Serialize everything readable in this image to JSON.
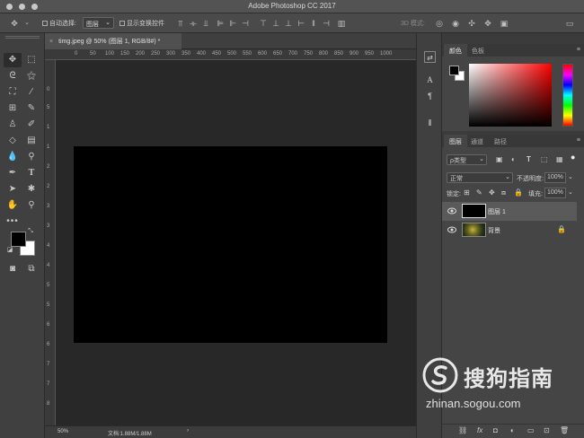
{
  "window": {
    "title": "Adobe Photoshop CC 2017"
  },
  "options_bar": {
    "auto_select_label": "自动选择:",
    "auto_select_value": "图层",
    "show_transform_label": "显示变换控件",
    "mode_3d_label": "3D 模式:"
  },
  "document": {
    "tab_label": "timg.jpeg @ 50% (图层 1, RGB/8#) *",
    "close_glyph": "×",
    "ruler_h": [
      "0",
      "50",
      "100",
      "150",
      "200",
      "250",
      "300",
      "350",
      "400",
      "450",
      "500",
      "550",
      "600",
      "650",
      "700",
      "750",
      "800",
      "850",
      "900",
      "950",
      "1000"
    ],
    "ruler_v": [
      "0",
      "5",
      "1",
      "1",
      "2",
      "2",
      "3",
      "3",
      "4",
      "4",
      "5",
      "5",
      "6",
      "6",
      "7",
      "7",
      "8"
    ],
    "zoom": "50%",
    "doc_info": "文档:1.88M/1.88M",
    "status_arrow": "›",
    "fill_color": "#000000"
  },
  "color_panel": {
    "tabs": [
      "颜色",
      "色板"
    ],
    "foreground": "#000000",
    "background": "#ffffff",
    "hue": "#ff0000"
  },
  "layers_panel": {
    "tabs": [
      "图层",
      "通道",
      "路径"
    ],
    "filter_label": "ρ类型",
    "blend_mode": "正常",
    "opacity_label": "不透明度:",
    "opacity_value": "100%",
    "lock_label": "锁定:",
    "fill_label": "填充:",
    "fill_value": "100%",
    "layers": [
      {
        "name": "图层 1",
        "selected": true,
        "thumb": "black-fill"
      },
      {
        "name": "背景",
        "selected": false,
        "thumb": "photo",
        "locked": true
      }
    ],
    "footer_icons": [
      "link-icon",
      "fx-icon",
      "mask-icon",
      "adjustment-icon",
      "group-icon",
      "new-layer-icon",
      "trash-icon"
    ],
    "fx_label": "fx"
  },
  "watermark": {
    "brand": "搜狗指南",
    "url": "zhinan.sogou.com"
  }
}
